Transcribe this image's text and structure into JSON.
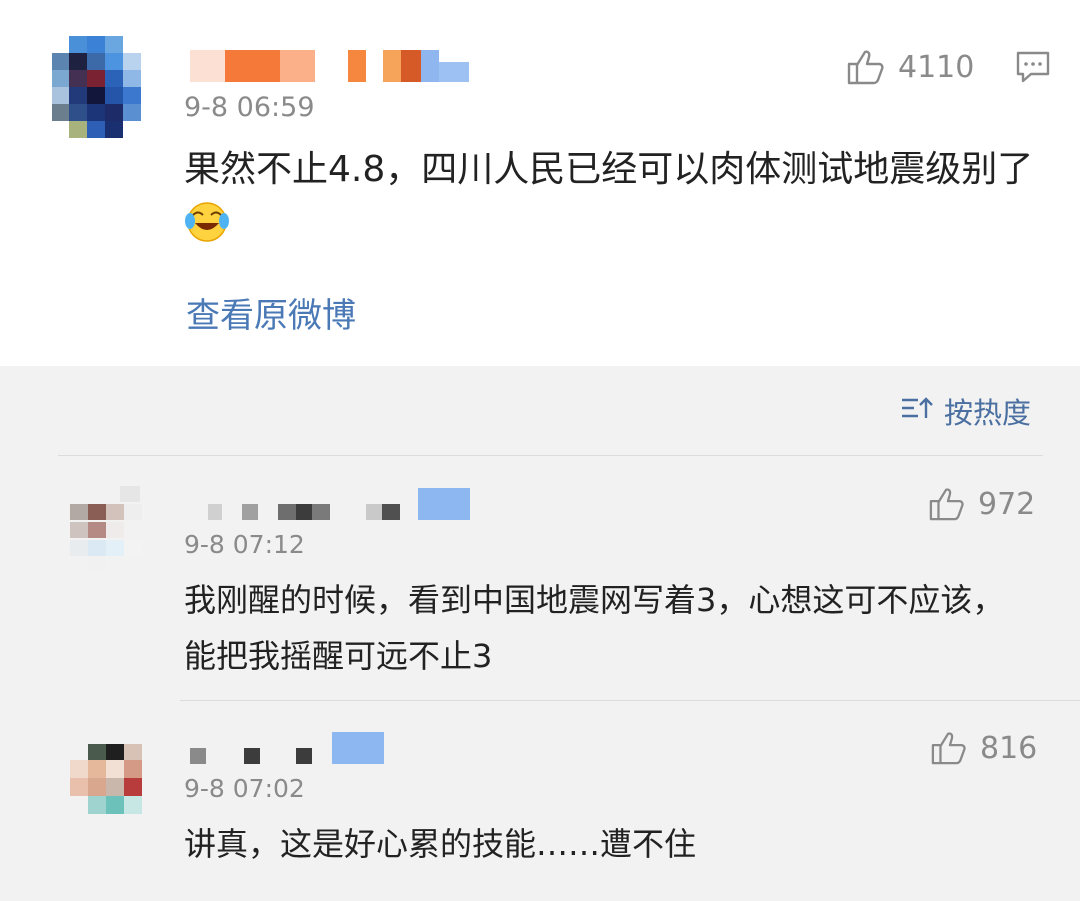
{
  "post": {
    "time": "9-8 06:59",
    "text": "果然不止4.8，四川人民已经可以肉体测试地震级别了",
    "likes": "4110",
    "view_original": "查看原微博",
    "emoji_icon": "laughing-tears-icon"
  },
  "sort_label": "按热度",
  "comments": [
    {
      "time": "9-8 07:12",
      "text": "我刚醒的时候，看到中国地震网写着3，心想这可不应该，能把我摇醒可远不止3",
      "likes": "972"
    },
    {
      "time": "9-8 07:02",
      "text": "讲真，这是好心累的技能……遭不住",
      "likes": "816"
    }
  ],
  "colors": {
    "link": "#4a79b6",
    "muted": "#8a8a8a",
    "text": "#222222",
    "bg": "#f2f2f2"
  }
}
